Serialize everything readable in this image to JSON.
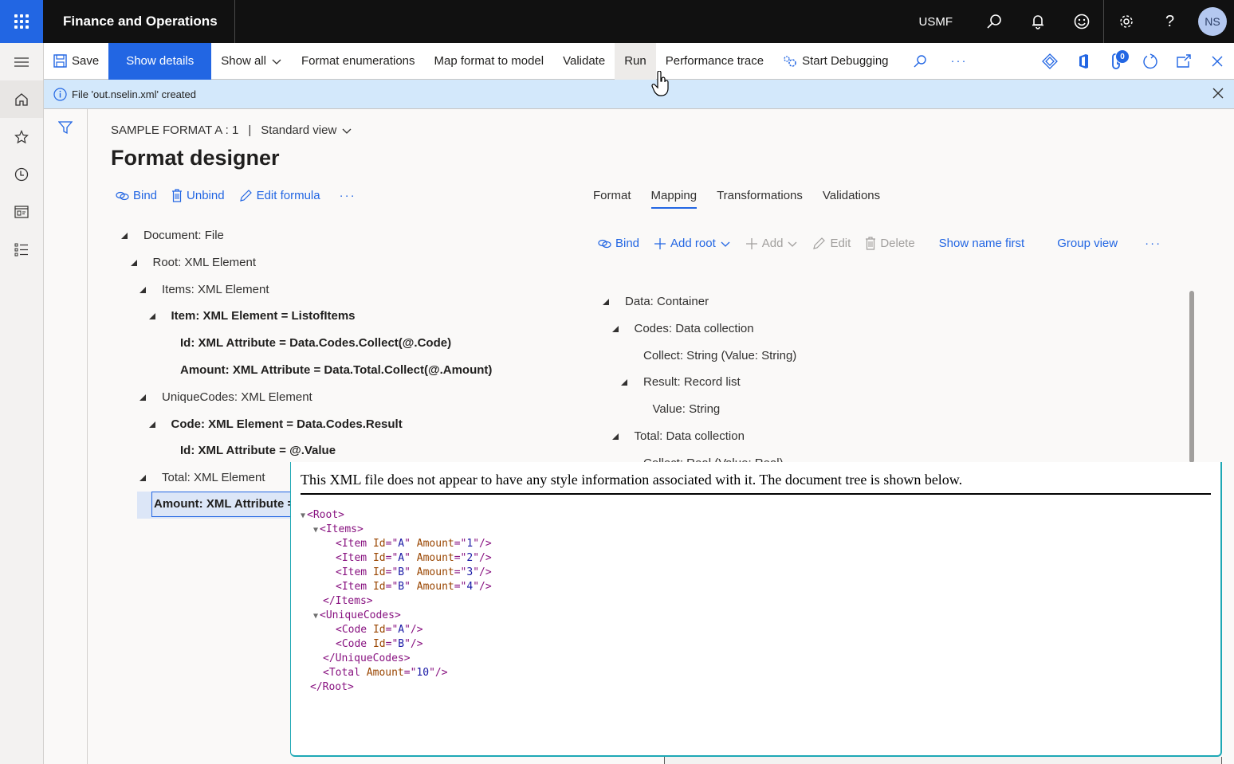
{
  "topbar": {
    "app_title": "Finance and Operations",
    "company": "USMF",
    "avatar_initials": "NS",
    "icons": [
      "search-icon",
      "bell-icon",
      "smiley-icon",
      "gear-icon",
      "help-icon"
    ]
  },
  "leftrail": {
    "items": [
      "menu-icon",
      "home-icon",
      "star-icon",
      "clock-icon",
      "workspace-icon",
      "list-icon"
    ]
  },
  "actionpane": {
    "save": "Save",
    "show_details": "Show details",
    "show_all": "Show all",
    "format_enumerations": "Format enumerations",
    "map_format_to_model": "Map format to model",
    "validate": "Validate",
    "run": "Run",
    "performance_trace": "Performance trace",
    "start_debugging": "Start Debugging",
    "more": "···",
    "attachments_count": "0"
  },
  "message": {
    "text": "File 'out.nselin.xml' created"
  },
  "caption": {
    "record": "SAMPLE FORMAT A : 1",
    "separator": "|",
    "view": "Standard view"
  },
  "page_title": "Format designer",
  "left_toolbar": {
    "bind": "Bind",
    "unbind": "Unbind",
    "edit_formula": "Edit formula",
    "more": "···"
  },
  "format_tree": [
    {
      "label": "Document: File",
      "level": 0,
      "expanded": true,
      "bold": false
    },
    {
      "label": "Root: XML Element",
      "level": 1,
      "expanded": true,
      "bold": false
    },
    {
      "label": "Items: XML Element",
      "level": 2,
      "expanded": true,
      "bold": false
    },
    {
      "label": "Item: XML Element = ListofItems",
      "level": 3,
      "expanded": true,
      "bold": true
    },
    {
      "label": "Id: XML Attribute = Data.Codes.Collect(@.Code)",
      "level": 4,
      "expanded": false,
      "bold": true
    },
    {
      "label": "Amount: XML Attribute = Data.Total.Collect(@.Amount)",
      "level": 4,
      "expanded": false,
      "bold": true
    },
    {
      "label": "UniqueCodes: XML Element",
      "level": 2,
      "expanded": true,
      "bold": false
    },
    {
      "label": "Code: XML Element = Data.Codes.Result",
      "level": 3,
      "expanded": true,
      "bold": true
    },
    {
      "label": "Id: XML Attribute = @.Value",
      "level": 4,
      "expanded": false,
      "bold": true
    },
    {
      "label": "Total: XML Element",
      "level": 2,
      "expanded": true,
      "bold": false
    },
    {
      "label": "Amount: XML Attribute = Data.Total.Collect(@.Amount)",
      "level": 3,
      "expanded": false,
      "bold": true,
      "selected": true
    }
  ],
  "tabs": [
    {
      "label": "Format",
      "active": false
    },
    {
      "label": "Mapping",
      "active": true
    },
    {
      "label": "Transformations",
      "active": false
    },
    {
      "label": "Validations",
      "active": false
    }
  ],
  "right_toolbar": {
    "bind": "Bind",
    "add_root": "Add root",
    "add": "Add",
    "edit": "Edit",
    "delete": "Delete",
    "show_name_first": "Show name first",
    "group_view": "Group view",
    "more": "···"
  },
  "model_tree": [
    {
      "label": "Data: Container",
      "level": 0,
      "expanded": true
    },
    {
      "label": "Codes: Data collection",
      "level": 1,
      "expanded": true
    },
    {
      "label": "Collect: String (Value: String)",
      "level": 2,
      "expanded": false
    },
    {
      "label": "Result: Record list",
      "level": 2,
      "expanded": true
    },
    {
      "label": "Value: String",
      "level": 3,
      "expanded": false
    },
    {
      "label": "Total: Data collection",
      "level": 1,
      "expanded": true
    },
    {
      "label": "Collect: Real (Value: Real)",
      "level": 2,
      "expanded": false
    }
  ],
  "xml_viewer": {
    "notice": "This XML file does not appear to have any style information associated with it. The document tree is shown below.",
    "lines": [
      {
        "indent": 0,
        "toggle": true,
        "parts": [
          [
            "tag",
            "<Root>"
          ]
        ]
      },
      {
        "indent": 1,
        "toggle": true,
        "parts": [
          [
            "tag",
            "<Items>"
          ]
        ]
      },
      {
        "indent": 2,
        "toggle": false,
        "parts": [
          [
            "tag",
            "<Item "
          ],
          [
            "attr",
            "Id"
          ],
          [
            "tag",
            "=\""
          ],
          [
            "val",
            "A"
          ],
          [
            "tag",
            "\" "
          ],
          [
            "attr",
            "Amount"
          ],
          [
            "tag",
            "=\""
          ],
          [
            "val",
            "1"
          ],
          [
            "tag",
            "\"/>"
          ]
        ]
      },
      {
        "indent": 2,
        "toggle": false,
        "parts": [
          [
            "tag",
            "<Item "
          ],
          [
            "attr",
            "Id"
          ],
          [
            "tag",
            "=\""
          ],
          [
            "val",
            "A"
          ],
          [
            "tag",
            "\" "
          ],
          [
            "attr",
            "Amount"
          ],
          [
            "tag",
            "=\""
          ],
          [
            "val",
            "2"
          ],
          [
            "tag",
            "\"/>"
          ]
        ]
      },
      {
        "indent": 2,
        "toggle": false,
        "parts": [
          [
            "tag",
            "<Item "
          ],
          [
            "attr",
            "Id"
          ],
          [
            "tag",
            "=\""
          ],
          [
            "val",
            "B"
          ],
          [
            "tag",
            "\" "
          ],
          [
            "attr",
            "Amount"
          ],
          [
            "tag",
            "=\""
          ],
          [
            "val",
            "3"
          ],
          [
            "tag",
            "\"/>"
          ]
        ]
      },
      {
        "indent": 2,
        "toggle": false,
        "parts": [
          [
            "tag",
            "<Item "
          ],
          [
            "attr",
            "Id"
          ],
          [
            "tag",
            "=\""
          ],
          [
            "val",
            "B"
          ],
          [
            "tag",
            "\" "
          ],
          [
            "attr",
            "Amount"
          ],
          [
            "tag",
            "=\""
          ],
          [
            "val",
            "4"
          ],
          [
            "tag",
            "\"/>"
          ]
        ]
      },
      {
        "indent": 1,
        "toggle": false,
        "parts": [
          [
            "tag",
            "</Items>"
          ]
        ]
      },
      {
        "indent": 1,
        "toggle": true,
        "parts": [
          [
            "tag",
            "<UniqueCodes>"
          ]
        ]
      },
      {
        "indent": 2,
        "toggle": false,
        "parts": [
          [
            "tag",
            "<Code "
          ],
          [
            "attr",
            "Id"
          ],
          [
            "tag",
            "=\""
          ],
          [
            "val",
            "A"
          ],
          [
            "tag",
            "\"/>"
          ]
        ]
      },
      {
        "indent": 2,
        "toggle": false,
        "parts": [
          [
            "tag",
            "<Code "
          ],
          [
            "attr",
            "Id"
          ],
          [
            "tag",
            "=\""
          ],
          [
            "val",
            "B"
          ],
          [
            "tag",
            "\"/>"
          ]
        ]
      },
      {
        "indent": 1,
        "toggle": false,
        "parts": [
          [
            "tag",
            "</UniqueCodes>"
          ]
        ]
      },
      {
        "indent": 1,
        "toggle": false,
        "parts": [
          [
            "tag",
            "<Total "
          ],
          [
            "attr",
            "Amount"
          ],
          [
            "tag",
            "=\""
          ],
          [
            "val",
            "10"
          ],
          [
            "tag",
            "\"/>"
          ]
        ]
      },
      {
        "indent": 0,
        "toggle": false,
        "parts": [
          [
            "tag",
            "</Root>"
          ]
        ]
      }
    ]
  },
  "colors": {
    "brand": "#2266e3",
    "topbar": "#111111",
    "message_bg": "#d3e8fb",
    "selection": "#dce6f7",
    "xml_tag": "#881280",
    "xml_attr": "#994500",
    "xml_value": "#1a1aa6",
    "viewer_border": "#1ea8b5"
  }
}
